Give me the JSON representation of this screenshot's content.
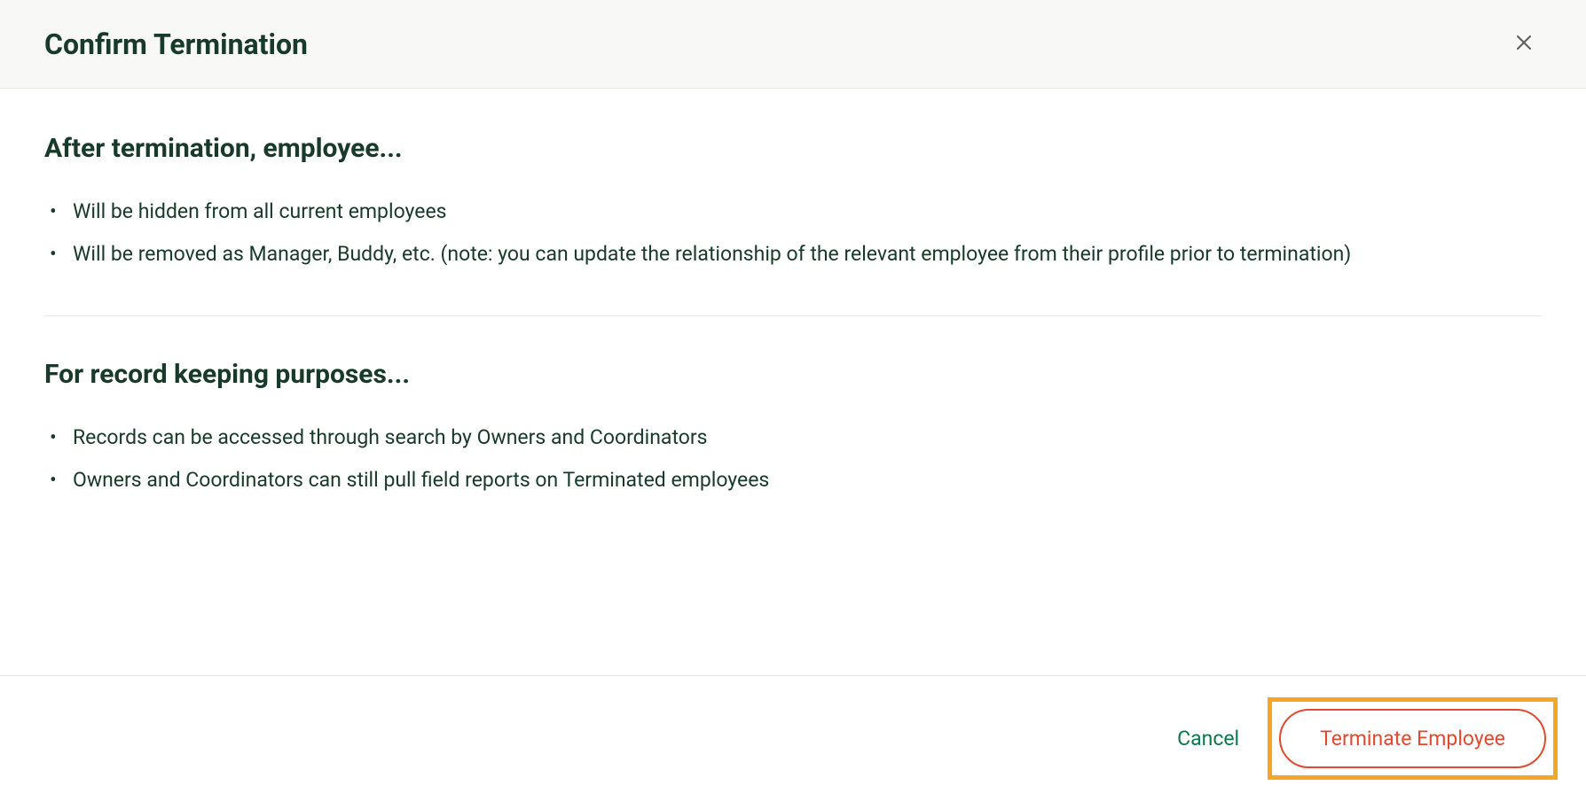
{
  "header": {
    "title": "Confirm Termination"
  },
  "sections": [
    {
      "title": "After termination, employee...",
      "items": [
        "Will be hidden from all current employees",
        "Will be removed as Manager, Buddy, etc. (note: you can update the relationship of the relevant employee from their profile prior to termination)"
      ]
    },
    {
      "title": "For record keeping purposes...",
      "items": [
        "Records can be accessed through search by Owners and Coordinators",
        "Owners and Coordinators can still pull field reports on Terminated employees"
      ]
    }
  ],
  "footer": {
    "cancel_label": "Cancel",
    "terminate_label": "Terminate Employee"
  }
}
